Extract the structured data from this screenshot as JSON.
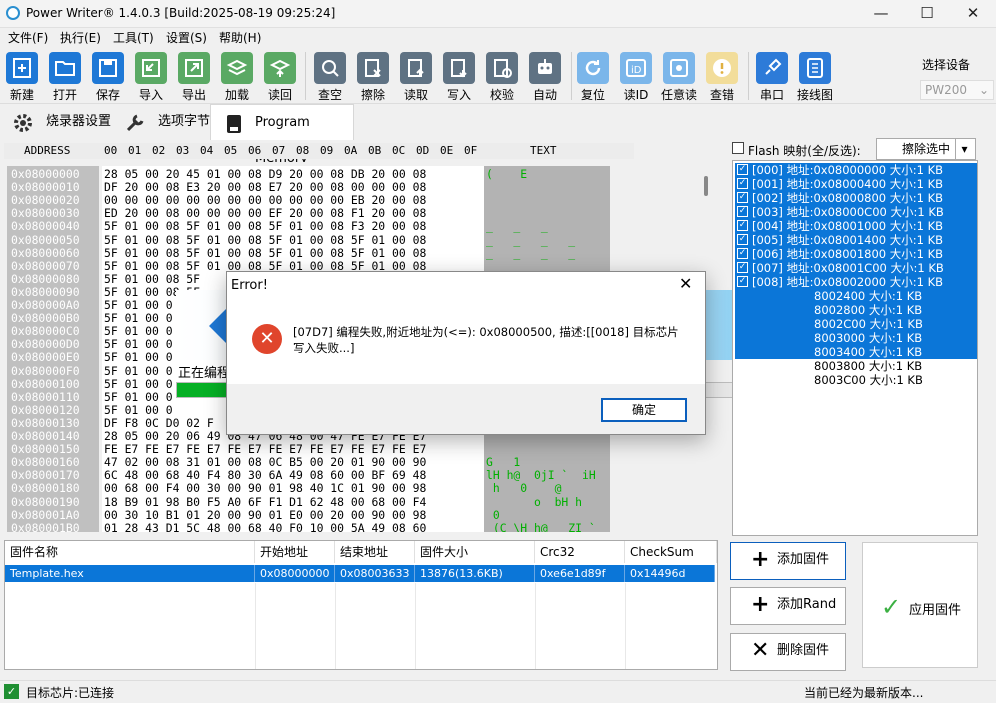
{
  "window": {
    "title": "Power Writer® 1.4.0.3 [Build:2025-08-19 09:25:24]"
  },
  "menu": [
    "文件(F)",
    "执行(E)",
    "工具(T)",
    "设置(S)",
    "帮助(H)"
  ],
  "toolbar": [
    {
      "label": "新建",
      "icon": "new-icon"
    },
    {
      "label": "打开",
      "icon": "open-folder-icon"
    },
    {
      "label": "保存",
      "icon": "save-icon"
    },
    {
      "label": "导入",
      "icon": "import-icon"
    },
    {
      "label": "导出",
      "icon": "export-icon"
    },
    {
      "label": "加载",
      "icon": "load-icon"
    },
    {
      "label": "读回",
      "icon": "readback-icon"
    },
    {
      "label": "查空",
      "icon": "search-icon"
    },
    {
      "label": "擦除",
      "icon": "erase-icon"
    },
    {
      "label": "读取",
      "icon": "read-icon"
    },
    {
      "label": "写入",
      "icon": "write-icon"
    },
    {
      "label": "校验",
      "icon": "verify-icon"
    },
    {
      "label": "自动",
      "icon": "robot-icon"
    },
    {
      "label": "复位",
      "icon": "reset-icon"
    },
    {
      "label": "读ID",
      "icon": "id-icon"
    },
    {
      "label": "任意读",
      "icon": "any-read-icon"
    },
    {
      "label": "查错",
      "icon": "warning-icon"
    },
    {
      "label": "串口",
      "icon": "serial-plug-icon"
    },
    {
      "label": "接线图",
      "icon": "wiring-icon"
    }
  ],
  "device": {
    "label": "选择设备",
    "value": "PW200"
  },
  "tabs": [
    "烧录器设置",
    "选项字节",
    "Program Memory"
  ],
  "hex": {
    "headers": [
      "ADDRESS",
      "00",
      "01",
      "02",
      "03",
      "04",
      "05",
      "06",
      "07",
      "08",
      "09",
      "0A",
      "0B",
      "0C",
      "0D",
      "0E",
      "0F",
      "TEXT"
    ],
    "rows": [
      {
        "addr": "0x08000000",
        "bytes": "28 05 00 20 45 01 00 08 D9 20 00 08 DB 20 00 08",
        "text": "(    E        "
      },
      {
        "addr": "0x08000010",
        "bytes": "DF 20 00 08 E3 20 00 08 E7 20 00 08 00 00 00 08",
        "text": ""
      },
      {
        "addr": "0x08000020",
        "bytes": "00 00 00 00 00 00 00 00 00 00 00 00 EB 20 00 08",
        "text": ""
      },
      {
        "addr": "0x08000030",
        "bytes": "ED 20 00 08 00 00 00 00 EF 20 00 08 F1 20 00 08",
        "text": ""
      },
      {
        "addr": "0x08000040",
        "bytes": "5F 01 00 08 5F 01 00 08 5F 01 00 08 F3 20 00 08",
        "text": "_   _   _"
      },
      {
        "addr": "0x08000050",
        "bytes": "5F 01 00 08 5F 01 00 08 5F 01 00 08 5F 01 00 08",
        "text": "_   _   _   _"
      },
      {
        "addr": "0x08000060",
        "bytes": "5F 01 00 08 5F 01 00 08 5F 01 00 08 5F 01 00 08",
        "text": "_   _   _   _"
      },
      {
        "addr": "0x08000070",
        "bytes": "5F 01 00 08 5F 01 00 08 5F 01 00 08 5F 01 00 08",
        "text": "_   _   _   _"
      },
      {
        "addr": "0x08000080",
        "bytes": "5F 01 00 08 5F",
        "text": ""
      },
      {
        "addr": "0x08000090",
        "bytes": "5F 01 00 08 5F",
        "text": ""
      },
      {
        "addr": "0x080000A0",
        "bytes": "5F 01 00 0",
        "text": ""
      },
      {
        "addr": "0x080000B0",
        "bytes": "5F 01 00 0",
        "text": ""
      },
      {
        "addr": "0x080000C0",
        "bytes": "5F 01 00 0",
        "text": ""
      },
      {
        "addr": "0x080000D0",
        "bytes": "5F 01 00 0",
        "text": ""
      },
      {
        "addr": "0x080000E0",
        "bytes": "5F 01 00 0",
        "text": ""
      },
      {
        "addr": "0x080000F0",
        "bytes": "5F 01 00 0",
        "text": ""
      },
      {
        "addr": "0x08000100",
        "bytes": "5F 01 00 0",
        "text": ""
      },
      {
        "addr": "0x08000110",
        "bytes": "5F 01 00 0",
        "text": ""
      },
      {
        "addr": "0x08000120",
        "bytes": "5F 01 00 0",
        "text": ""
      },
      {
        "addr": "0x08000130",
        "bytes": "DF F8 0C D0 02 F",
        "text": ""
      },
      {
        "addr": "0x08000140",
        "bytes": "28 05 00 20 06 49 08 47 06 48 00 47 FE E7 FE E7",
        "text": ""
      },
      {
        "addr": "0x08000150",
        "bytes": "FE E7 FE E7 FE E7 FE E7 FE E7 FE E7 FE E7 FE E7",
        "text": ""
      },
      {
        "addr": "0x08000160",
        "bytes": "47 02 00 08 31 01 00 08 0C B5 00 20 01 90 00 90",
        "text": "G   1     "
      },
      {
        "addr": "0x08000170",
        "bytes": "6C 48 00 68 40 F4 80 30 6A 49 08 60 00 BF 69 48",
        "text": "lH h@  0jI `  iH"
      },
      {
        "addr": "0x08000180",
        "bytes": "00 68 00 F4 00 30 00 90 01 98 40 1C 01 90 00 98",
        "text": " h   0    @     "
      },
      {
        "addr": "0x08000190",
        "bytes": "18 B9 01 98 B0 F5 A0 6F F1 D1 62 48 00 68 00 F4",
        "text": "       o  bH h  "
      },
      {
        "addr": "0x080001A0",
        "bytes": "00 30 10 B1 01 20 00 90 01 E0 00 20 00 90 00 98",
        "text": " 0              "
      },
      {
        "addr": "0x080001B0",
        "bytes": "01 28 43 D1 5C 48 00 68 40 F0 10 00 5A 49 08 60",
        "text": " (C \\H h@   ZI `"
      }
    ]
  },
  "progress": {
    "text": "正在编程"
  },
  "flash": {
    "label": "Flash 映射(全/反选):",
    "erase_button": "擦除选中"
  },
  "sectors": [
    "[000] 地址:0x08000000 大小:1 KB",
    "[001] 地址:0x08000400 大小:1 KB",
    "[002] 地址:0x08000800 大小:1 KB",
    "[003] 地址:0x08000C00 大小:1 KB",
    "[004] 地址:0x08001000 大小:1 KB",
    "[005] 地址:0x08001400 大小:1 KB",
    "[006] 地址:0x08001800 大小:1 KB",
    "[007] 地址:0x08001C00 大小:1 KB",
    "[008] 地址:0x08002000 大小:1 KB",
    "8002400 大小:1 KB",
    "8002800 大小:1 KB",
    "8002C00 大小:1 KB",
    "8003000 大小:1 KB",
    "8003400 大小:1 KB",
    "8003800 大小:1 KB",
    "8003C00 大小:1 KB"
  ],
  "firmware": {
    "headers": [
      "固件名称",
      "开始地址",
      "结束地址",
      "固件大小",
      "Crc32",
      "CheckSum"
    ],
    "row": [
      "Template.hex",
      "0x08000000",
      "0x08003633",
      "13876(13.6KB)",
      "0xe6e1d89f",
      "0x14496d"
    ]
  },
  "actions": {
    "add_fw": "添加固件",
    "add_rand": "添加Rand",
    "del_fw": "删除固件",
    "apply": "应用固件"
  },
  "status": {
    "left": "目标芯片:已连接",
    "right": "当前已经为最新版本..."
  },
  "dialog": {
    "title": "Error!",
    "message": "[07D7] 编程失败,附近地址为(<=): 0x08000500, 描述:[[0018] 目标芯片写入失败...]",
    "ok": "确定"
  }
}
